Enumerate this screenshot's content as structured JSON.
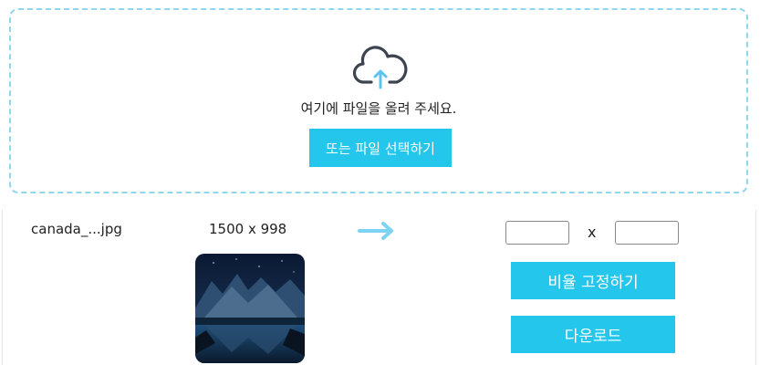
{
  "upload": {
    "icon": "cloud-upload-icon",
    "drop_text": "여기에 파일을 올려 주세요.",
    "select_button": "또는 파일 선택하기"
  },
  "file": {
    "name": "canada_...jpg",
    "dimensions": "1500 x 998",
    "arrow_icon": "arrow-right-icon"
  },
  "resize": {
    "width_value": "",
    "height_value": "",
    "separator": "x",
    "lock_ratio_button": "비율 고정하기",
    "download_button": "다운로드"
  },
  "colors": {
    "accent": "#25c6ec",
    "dashed_border": "#8fd6ef",
    "arrow": "#7dd3f3"
  }
}
